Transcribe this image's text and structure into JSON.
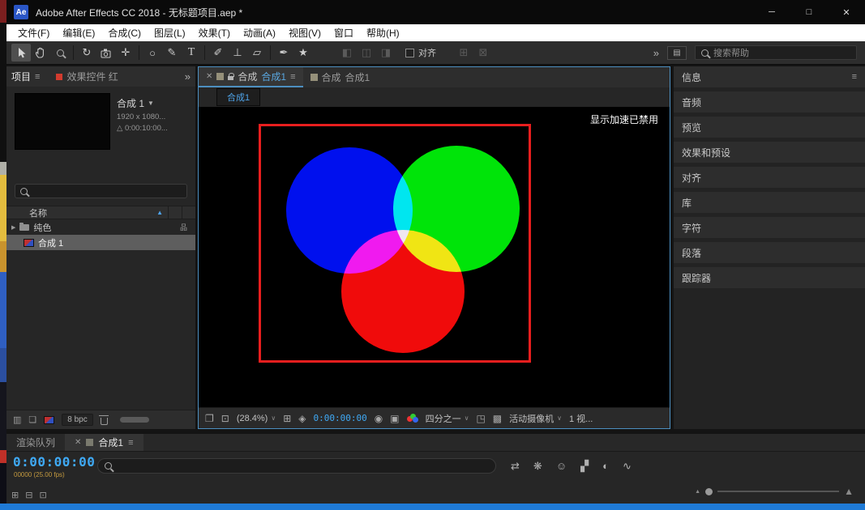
{
  "titlebar": {
    "app_icon_text": "Ae",
    "title": "Adobe After Effects CC 2018 - 无标题项目.aep *",
    "minimize_glyph": "─",
    "maximize_glyph": "□",
    "close_glyph": "✕"
  },
  "menubar": {
    "items": [
      "文件(F)",
      "编辑(E)",
      "合成(C)",
      "图层(L)",
      "效果(T)",
      "动画(A)",
      "视图(V)",
      "窗口",
      "帮助(H)"
    ]
  },
  "toolbar": {
    "tools": [
      {
        "name": "selection-tool"
      },
      {
        "name": "hand-tool"
      },
      {
        "name": "zoom-tool"
      },
      {
        "name": "rotate-tool",
        "glyph": "↻"
      },
      {
        "name": "unified-camera-tool"
      },
      {
        "name": "pan-behind-tool",
        "glyph": "✛"
      },
      {
        "name": "shape-tool",
        "glyph": "○"
      },
      {
        "name": "pen-tool",
        "glyph": "✎"
      },
      {
        "name": "type-tool",
        "glyph": "T"
      },
      {
        "name": "brush-tool",
        "glyph": "✐"
      },
      {
        "name": "clone-stamp-tool",
        "glyph": "⊥"
      },
      {
        "name": "eraser-tool",
        "glyph": "▱"
      },
      {
        "name": "roto-brush-tool",
        "glyph": "✒"
      },
      {
        "name": "puppet-pin-tool",
        "glyph": "★"
      }
    ],
    "axis_icons": [
      "◧",
      "◫",
      "◨"
    ],
    "snap_label": "对齐",
    "snap_icons": [
      "⊞",
      "⊠"
    ],
    "overflow_glyph": "»",
    "workspace_glyph": "▤",
    "search_placeholder": "搜索帮助"
  },
  "project_panel": {
    "tab_project": "项目",
    "tab_effect_controls": "效果控件 红",
    "preview": {
      "comp_name": "合成 1",
      "detail_line1": "1920 x 1080...",
      "detail_line2": "△ 0:00:10:00..."
    },
    "name_column": "名称",
    "rows": [
      {
        "label": "纯色"
      },
      {
        "label": "合成 1"
      }
    ],
    "bottom_icons": [
      {
        "name": "interpret-footage-icon",
        "glyph": "▥"
      },
      {
        "name": "new-folder-icon",
        "glyph": "❏"
      }
    ],
    "bpc_label": "8 bpc"
  },
  "comp_panel": {
    "tab_active": {
      "panel": "合成",
      "comp": "合成1"
    },
    "tab_secondary": {
      "panel": "合成",
      "comp": "合成1"
    },
    "breadcrumb": "合成1",
    "overlay_message": "显示加速已禁用",
    "zoom_label": "(28.4%)",
    "timecode": "0:00:00:00",
    "resolution_label": "四分之一",
    "camera_label": "活动摄像机",
    "view_layout_label": "1 视...",
    "bar_icons": [
      {
        "name": "always-preview-icon",
        "glyph": "❐"
      },
      {
        "name": "primary-viewer-icon",
        "glyph": "⊡"
      },
      {
        "name": "grid-options-icon",
        "glyph": "⊞"
      },
      {
        "name": "mask-visibility-icon",
        "glyph": "◈"
      },
      {
        "name": "snapshot-icon",
        "glyph": "◉"
      },
      {
        "name": "show-snapshot-icon",
        "glyph": "▣"
      },
      {
        "name": "roi-icon",
        "glyph": "◳"
      },
      {
        "name": "transparency-grid-icon",
        "glyph": "▩"
      }
    ],
    "circle_colors": {
      "blue": "#0010ee",
      "green": "#00e409",
      "red": "#f00b0b"
    },
    "frame_color": "#e81e1e"
  },
  "right_panels": {
    "items": [
      "信息",
      "音频",
      "预览",
      "效果和预设",
      "对齐",
      "库",
      "字符",
      "段落",
      "跟踪器"
    ]
  },
  "timeline": {
    "tab_render_queue": "渲染队列",
    "tab_comp": "合成1",
    "timecode": "0:00:00:00",
    "frame_info": "00000 (25.00 fps)",
    "tool_icons": [
      {
        "name": "comp-flowchart-icon",
        "glyph": "⇄"
      },
      {
        "name": "draft-3d-icon",
        "glyph": "❋"
      },
      {
        "name": "shy-icon",
        "glyph": "☺"
      },
      {
        "name": "frame-blend-icon",
        "glyph": "▞"
      },
      {
        "name": "motion-blur-icon",
        "glyph": "◐"
      },
      {
        "name": "graph-editor-icon",
        "glyph": "∿"
      }
    ],
    "bottom_icons": [
      {
        "name": "expand-layer-switches-icon",
        "glyph": "⊞"
      },
      {
        "name": "expand-transfer-controls-icon",
        "glyph": "⊟"
      },
      {
        "name": "expand-inout-icon",
        "glyph": "⊡"
      }
    ]
  },
  "glyphs": {
    "panel_menu": "≡",
    "overflow": "»",
    "tab_close": "✕",
    "dropdown_caret": "∨",
    "expand_arrow": "▶",
    "sort_ascending": "▲",
    "usage": "品",
    "preview_caret": "▼",
    "mountain_small": "▲",
    "mountain_large": "▲"
  },
  "colors": {
    "accent_blue": "#4ea3e8",
    "timecode_blue": "#3fa9f5",
    "frame_info_gold": "#c49a3f",
    "active_panel_border": "#4d8fc0",
    "taskbar_blue": "#1f7ad6"
  }
}
